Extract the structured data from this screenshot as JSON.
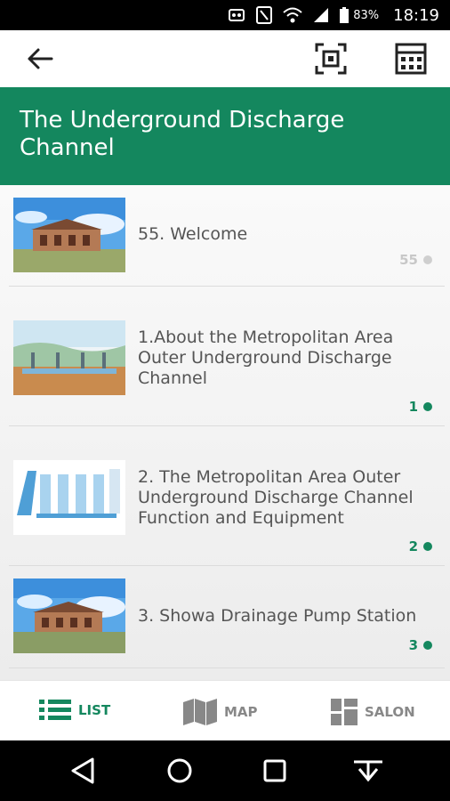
{
  "status": {
    "battery": "83%",
    "time": "18:19"
  },
  "header": {
    "title": "The Underground Discharge Channel"
  },
  "items": [
    {
      "label": "55. Welcome",
      "count": "55",
      "dot": "#cfcfcf",
      "count_color": "#c8c8c8"
    },
    {
      "label": "1.About the Metropolitan Area Outer Underground Discharge Channel",
      "count": "1",
      "dot": "#14875e",
      "count_color": "#14875e"
    },
    {
      "label": "2. The Metropolitan Area Outer Underground Discharge Channel Function and Equipment",
      "count": "2",
      "dot": "#14875e",
      "count_color": "#14875e"
    },
    {
      "label": "3. Showa Drainage Pump Station",
      "count": "3",
      "dot": "#14875e",
      "count_color": "#14875e"
    }
  ],
  "nav": {
    "list": "LIST",
    "map": "MAP",
    "salon": "SALON"
  },
  "colors": {
    "accent": "#14875e"
  }
}
